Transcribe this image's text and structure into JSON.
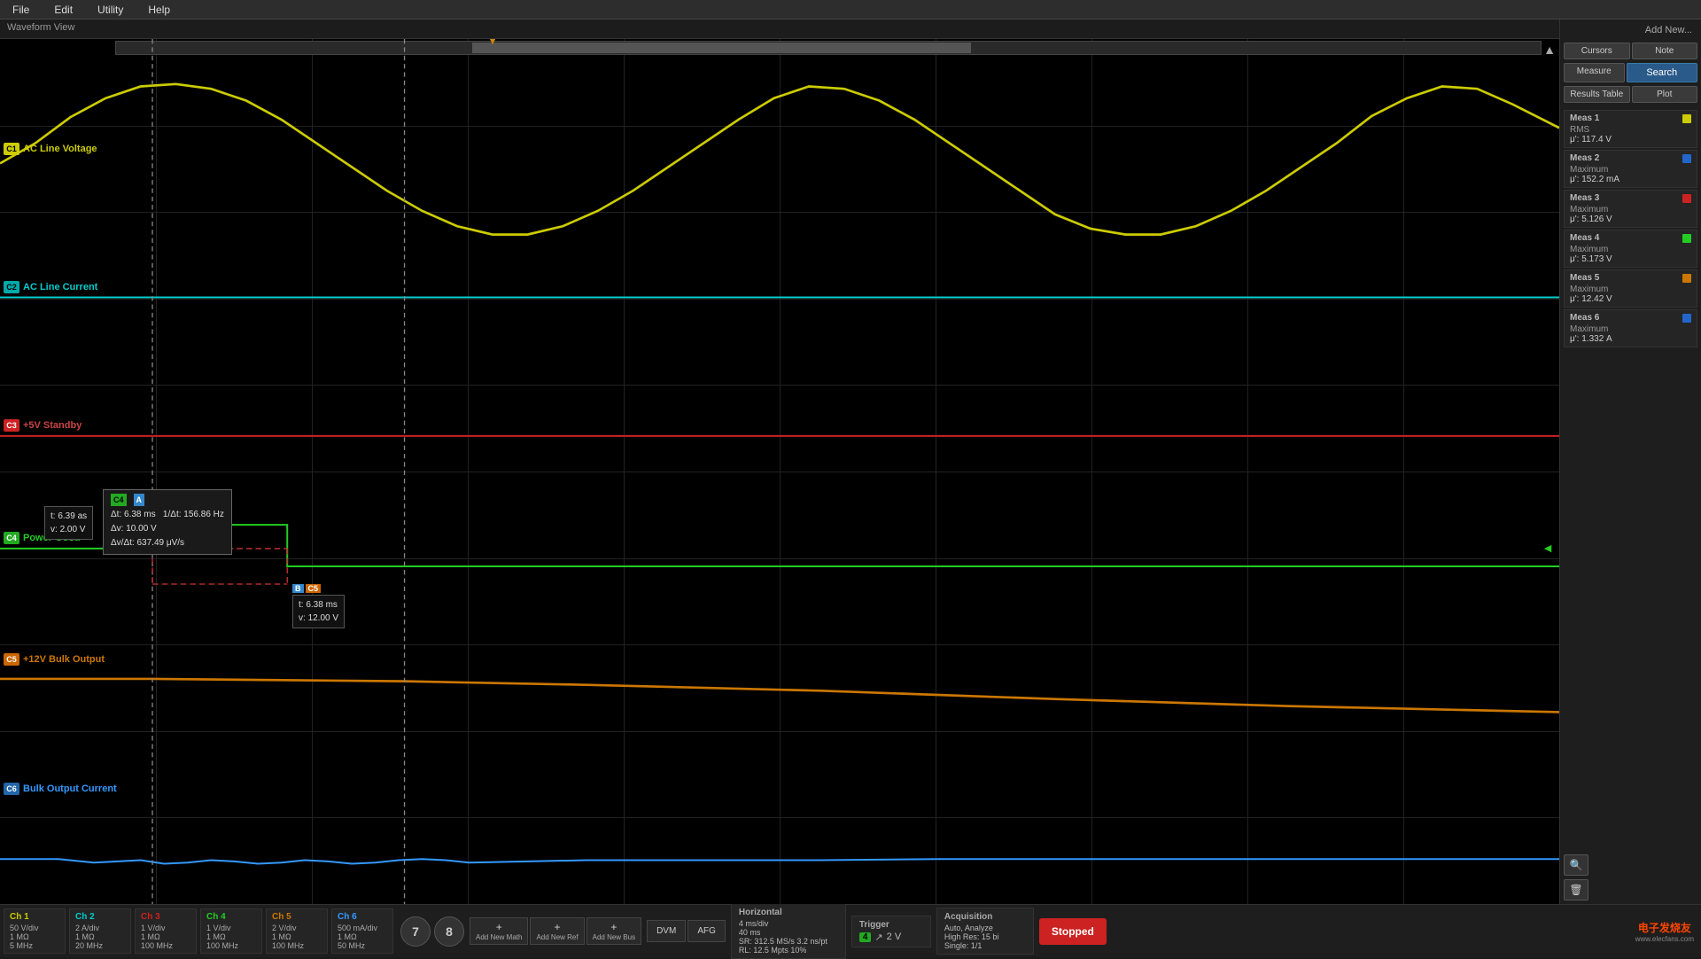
{
  "menubar": {
    "items": [
      "File",
      "Edit",
      "Utility",
      "Help"
    ]
  },
  "waveform": {
    "title": "Waveform View",
    "channels": [
      {
        "id": "C1",
        "label": "AC Line Voltage",
        "color": "#cccc00",
        "badge_color": "#cccc00",
        "y_pct": 14
      },
      {
        "id": "C2",
        "label": "AC Line Current",
        "color": "#00cccc",
        "badge_color": "#00aaaa",
        "y_pct": 30
      },
      {
        "id": "C3",
        "label": "+5V Standby",
        "color": "#cc2222",
        "badge_color": "#cc2222",
        "y_pct": 46
      },
      {
        "id": "C4",
        "label": "Power Good",
        "color": "#22cc22",
        "badge_color": "#22aa22",
        "y_pct": 60
      },
      {
        "id": "C5",
        "label": "+12V Bulk Output",
        "color": "#cc7700",
        "badge_color": "#cc6600",
        "y_pct": 74
      },
      {
        "id": "C6",
        "label": "Bulk Output Current",
        "color": "#3399ff",
        "badge_color": "#2277cc",
        "y_pct": 89
      }
    ],
    "cursor_meas": {
      "delta_t": "6.38 ms",
      "inv_delta_t": "156.86 Hz",
      "delta_v": "10.00 V",
      "delta_v_per_dt": "637.49 μV/s"
    },
    "cursor_a": {
      "t": "6.39 as",
      "v": "2.00 V"
    },
    "cursor_b": {
      "t": "6.38 ms",
      "v": "12.00 V"
    }
  },
  "right_panel": {
    "add_new_label": "Add New...",
    "buttons": {
      "cursors": "Cursors",
      "note": "Note",
      "measure": "Measure",
      "search": "Search",
      "results_table": "Results Table",
      "plot": "Plot"
    },
    "measurements": [
      {
        "id": "Meas 1",
        "color": "#cccc00",
        "type": "RMS",
        "value": "μ': 117.4 V"
      },
      {
        "id": "Meas 2",
        "color": "#2266cc",
        "type": "Maximum",
        "value": "μ': 152.2 mA"
      },
      {
        "id": "Meas 3",
        "color": "#cc2222",
        "type": "Maximum",
        "value": "μ': 5.126 V"
      },
      {
        "id": "Meas 4",
        "color": "#22cc22",
        "type": "Maximum",
        "value": "μ': 5.173 V"
      },
      {
        "id": "Meas 5",
        "color": "#cc7700",
        "type": "Maximum",
        "value": "μ': 12.42 V"
      },
      {
        "id": "Meas 6",
        "color": "#2266cc",
        "type": "Maximum",
        "value": "μ': 1.332 A"
      }
    ]
  },
  "bottom": {
    "channels": [
      {
        "name": "Ch 1",
        "color": "#cccc00",
        "vals": [
          "50 V/div",
          "1 MΩ",
          "5 MHz"
        ]
      },
      {
        "name": "Ch 2",
        "color": "#00cccc",
        "vals": [
          "2 A/div",
          "1 MΩ",
          "20 MHz"
        ]
      },
      {
        "name": "Ch 3",
        "color": "#cc2222",
        "vals": [
          "1 V/div",
          "1 MΩ",
          "100 MHz"
        ]
      },
      {
        "name": "Ch 4",
        "color": "#22cc22",
        "vals": [
          "1 V/div",
          "1 MΩ",
          "100 MHz"
        ]
      },
      {
        "name": "Ch 5",
        "color": "#cc7700",
        "vals": [
          "2 V/div",
          "1 MΩ",
          "100 MHz"
        ]
      },
      {
        "name": "Ch 6",
        "color": "#3399ff",
        "vals": [
          "500 mA/div",
          "1 MΩ",
          "50 MHz"
        ]
      }
    ],
    "nav_buttons": [
      "7",
      "8"
    ],
    "add_buttons": [
      {
        "icon": "+",
        "label": "Add New Math"
      },
      {
        "icon": "+",
        "label": "Add New Ref"
      },
      {
        "icon": "+",
        "label": "Add New Bus"
      }
    ],
    "dvm_label": "DVM",
    "afg_label": "AFG",
    "horizontal": {
      "title": "Horizontal",
      "vals": [
        "4 ms/div",
        "40 ms",
        "SR: 312.5 MS/s  3.2 ns/pt",
        "RL: 12.5 Mpts  10%"
      ]
    },
    "trigger": {
      "title": "Trigger",
      "ch": "4",
      "slope": "↗",
      "level": "2 V"
    },
    "acquisition": {
      "title": "Acquisition",
      "mode": "Auto,  Analyze",
      "depth": "High Res: 15 bi",
      "count": "Single: 1/1"
    },
    "stop_btn": "Stopped"
  }
}
